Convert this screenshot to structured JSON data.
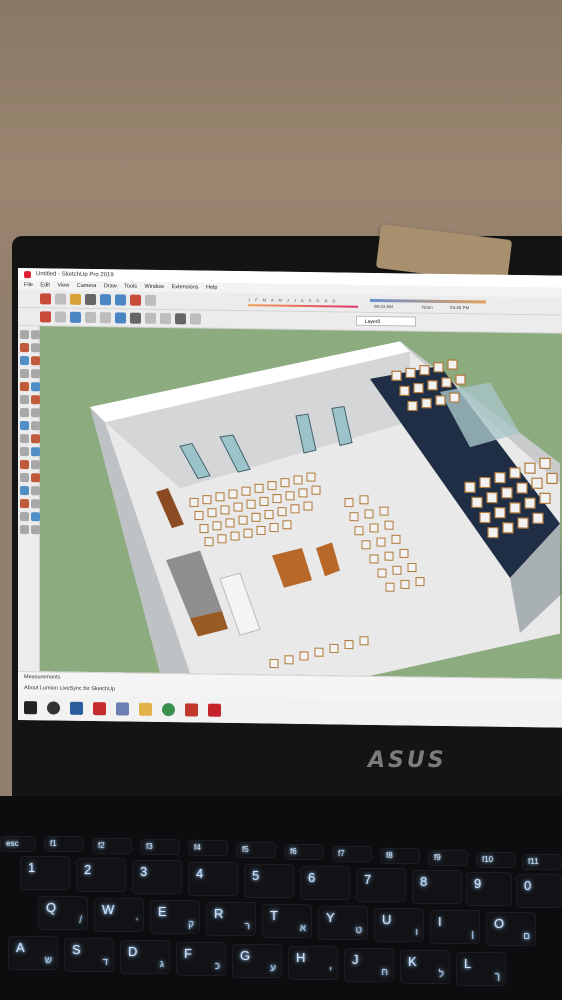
{
  "window": {
    "title": "Untitled - SketchUp Pro 2019"
  },
  "menu": [
    "File",
    "Edit",
    "View",
    "Camera",
    "Draw",
    "Tools",
    "Window",
    "Extensions",
    "Help"
  ],
  "shadow_months": "J F M A M J J A S O N D",
  "time": {
    "start": "06:43 AM",
    "noon": "Noon",
    "end": "04:45 PM"
  },
  "layer": {
    "current": "Layer0"
  },
  "status": {
    "measurements_label": "Measurements",
    "lumion_text": "About Lumion LiveSync for SketchUp"
  },
  "brand": "ASUS",
  "keys": {
    "fn_row": [
      "esc",
      "f1",
      "f2",
      "f3",
      "f4",
      "f5",
      "f6",
      "f7",
      "f8",
      "f9",
      "f10",
      "f11"
    ],
    "num_row": [
      "1",
      "2",
      "3",
      "4",
      "5",
      "6",
      "7",
      "8",
      "9",
      "0"
    ],
    "q_row": [
      "Q",
      "W",
      "E",
      "R",
      "T",
      "Y",
      "U",
      "I",
      "O"
    ],
    "q_row_sub": [
      "/",
      "'",
      "ק",
      "ר",
      "א",
      "ט",
      "ו",
      "ן",
      "ם"
    ],
    "a_row": [
      "A",
      "S",
      "D",
      "F",
      "G",
      "H",
      "J",
      "K",
      "L"
    ],
    "a_row_sub": [
      "ש",
      "ד",
      "ג",
      "כ",
      "ע",
      "י",
      "ח",
      "ל",
      "ך"
    ]
  },
  "colors": {
    "wall": "#9a8671",
    "viewport_ground": "#8cab7f",
    "key_glow": "#8fc8ff",
    "dark_stage": "#1f2e45"
  }
}
